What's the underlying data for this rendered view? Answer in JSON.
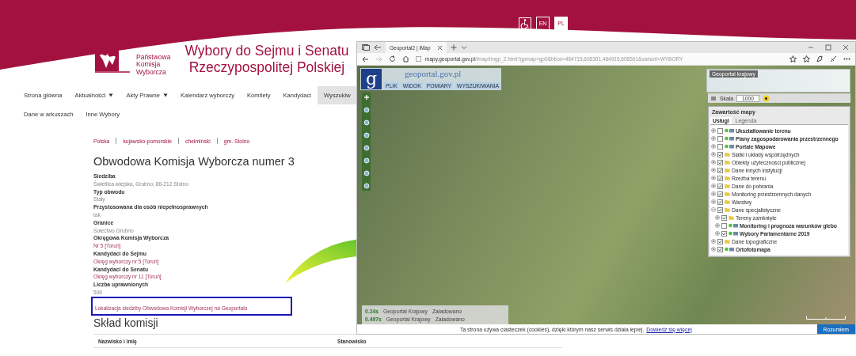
{
  "header": {
    "org_lines": [
      "Państwowa",
      "Komisja",
      "Wyborcza"
    ],
    "title_lines": [
      "Wybory do Sejmu i Senatu",
      "Rzeczypospolitej Polskiej"
    ],
    "language_buttons": [
      {
        "label": "EN",
        "selected": false
      },
      {
        "label": "PL",
        "selected": true
      }
    ]
  },
  "nav": {
    "rows": [
      [
        {
          "label": "Strona główna",
          "dropdown": false,
          "selected": false
        },
        {
          "label": "Aktualności",
          "dropdown": true,
          "selected": false
        },
        {
          "label": "Akty Prawne",
          "dropdown": true,
          "selected": false
        },
        {
          "label": "Kalendarz wyborczy",
          "dropdown": false,
          "selected": false
        },
        {
          "label": "Komitety",
          "dropdown": false,
          "selected": false
        },
        {
          "label": "Kandydaci",
          "dropdown": false,
          "selected": false
        },
        {
          "label": "Wyszukiw",
          "dropdown": false,
          "selected": true
        }
      ],
      [
        {
          "label": "Dane w arkuszach",
          "dropdown": false,
          "selected": false
        },
        {
          "label": "Inne Wybory",
          "dropdown": false,
          "selected": false
        }
      ]
    ]
  },
  "breadcrumb": [
    "Polska",
    "kujawsko-pomorskie",
    "chełmiński",
    "gm. Stolno"
  ],
  "heading": "Obwodowa Komisja Wyborcza numer 3",
  "fields": [
    {
      "label": "Siedziba",
      "value": "Świetlica wiejska, Grubno, 86-212 Stolno",
      "kind": "text"
    },
    {
      "label": "Typ obwodu",
      "value": "Stały",
      "kind": "text"
    },
    {
      "label": "Przystosowana dla osób niepełnosprawnych",
      "value": "tak",
      "kind": "text"
    },
    {
      "label": "Granice",
      "value": "Sołectwo Grubno",
      "kind": "text"
    },
    {
      "label": "Okręgowa Komisja Wyborcza",
      "value": "Nr 5 [Toruń]",
      "kind": "link"
    },
    {
      "label": "Kandydaci do Sejmu",
      "value": "Okręg wyborczy nr 5 [Toruń]",
      "kind": "link"
    },
    {
      "label": "Kandydaci do Senatu",
      "value": "Okręg wyborczy nr 11 [Toruń]",
      "kind": "link"
    },
    {
      "label": "Liczba uprawnionych",
      "value": "506",
      "kind": "text"
    }
  ],
  "geoportal_link": {
    "text": "Lokalizacja siedziby Obwodowa Komisji Wyborczej na Geoportalu",
    "highlighted": true
  },
  "composition": {
    "heading": "Skład komisji",
    "columns": [
      "Nazwisko i imię",
      "Stanowisko"
    ]
  },
  "browser": {
    "tab_title": "Geoportal2 | iMap",
    "url": "**mapy.geoportal.gov.pl**/imap/Imgp_2.html?gpmap=gp0&bbox=464715,608301,464915,608501&variant=WYBORY",
    "map": {
      "logo_letter": "g",
      "logo_text": "geoportal.gov.pl",
      "menu": [
        "PLIK",
        "WIDOK",
        "POMIARY",
        "WYSZUKIWANIA"
      ],
      "overview_title": "Geoportal krajowy",
      "scale_label": "Skala",
      "scale_value": "1000",
      "panel_title": "Zawartość mapy",
      "panel_tabs": [
        {
          "label": "Usługi",
          "selected": true
        },
        {
          "label": "Legenda",
          "selected": false
        }
      ],
      "layers": [
        {
          "label": "Ukształtowanie terenu",
          "kind": "service",
          "checked": false,
          "expanded": false
        },
        {
          "label": "Plany zagospodarowania przestrzennego",
          "kind": "service",
          "checked": false,
          "expanded": false
        },
        {
          "label": "Portale Mapowe",
          "kind": "service",
          "checked": false,
          "expanded": false
        },
        {
          "label": "Siatki i układy współrzędnych",
          "kind": "folder",
          "checked": true,
          "expanded": false
        },
        {
          "label": "Obiekty użyteczności publicznej",
          "kind": "folder",
          "checked": true,
          "expanded": false
        },
        {
          "label": "Dane innych instytucji",
          "kind": "folder",
          "checked": true,
          "expanded": false
        },
        {
          "label": "Rzeźba terenu",
          "kind": "folder",
          "checked": true,
          "expanded": false
        },
        {
          "label": "Dane do pobrania",
          "kind": "folder",
          "checked": true,
          "expanded": false
        },
        {
          "label": "Monitoring przestrzennych danych",
          "kind": "folder",
          "checked": true,
          "expanded": false
        },
        {
          "label": "Warstwy",
          "kind": "folder",
          "checked": true,
          "expanded": false
        },
        {
          "label": "Dane specjalistyczne",
          "kind": "folder",
          "checked": true,
          "expanded": true,
          "children": [
            {
              "label": "Tereny zamknięte",
              "kind": "folder",
              "checked": true,
              "expanded": false
            },
            {
              "label": "Monitoring i prognoza warunków glebo",
              "kind": "service",
              "checked": false,
              "expanded": false
            },
            {
              "label": "Wybory Parlamentarne 2019",
              "kind": "service",
              "checked": true,
              "expanded": false
            }
          ]
        },
        {
          "label": "Dane topograficzne",
          "kind": "folder",
          "checked": true,
          "expanded": false
        },
        {
          "label": "Ortofotomapa",
          "kind": "service",
          "checked": true,
          "expanded": false
        }
      ],
      "load_status": [
        {
          "time": "0.24s",
          "source": "Geoportal Krajowy",
          "state": "Załadowano"
        },
        {
          "time": "0.497s",
          "source": "Geoportal Krajowy",
          "state": "Załadowano"
        }
      ]
    },
    "cookie_bar": {
      "text": "Ta strona używa ciasteczek (cookies), dzięki którym nasz serwis działa lepiej.",
      "link": "Dowiedz się więcej",
      "button": "Rozumiem"
    }
  }
}
